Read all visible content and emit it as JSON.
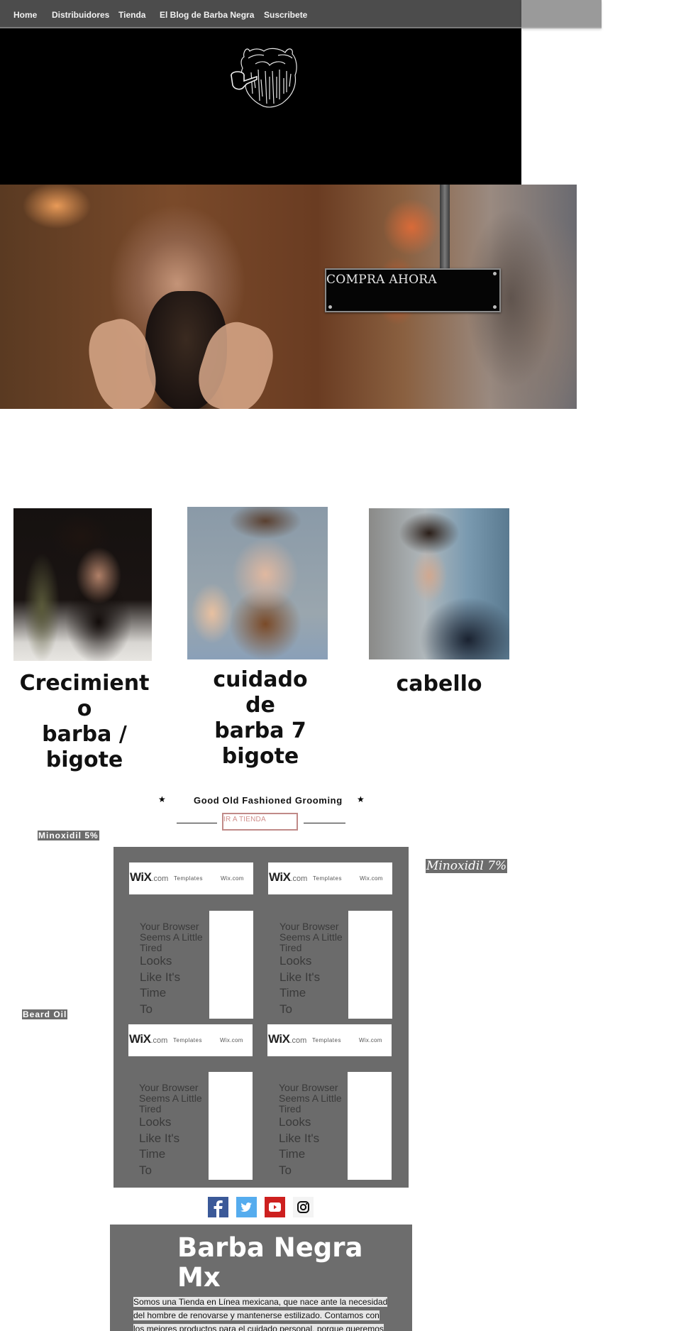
{
  "nav": {
    "items": [
      "Home",
      "Distribuidores",
      "Tienda",
      "El Blog de Barba Negra",
      "Suscribete"
    ]
  },
  "header": {
    "logo_alt": "Barba Negra beard and pipe logo"
  },
  "hero": {
    "cta_label": "COMPRA AHORA"
  },
  "categories": [
    {
      "title_lines": [
        "Crecimient",
        "o",
        "barba /",
        "bigote"
      ]
    },
    {
      "title_lines": [
        "cuidado",
        "de",
        "barba 7",
        "bigote"
      ]
    },
    {
      "title_lines": [
        "cabello"
      ]
    }
  ],
  "grooming": {
    "star": "★",
    "heading": "Good Old Fashioned Grooming",
    "button_label": "IR A TIENDA"
  },
  "products": {
    "minoxidil5": "Minoxidil 5%",
    "minoxidil7": "Minoxidil 7%",
    "beard_oil": "Beard Oil"
  },
  "wix_tiles": [
    {
      "logo": "WiX",
      "logo_suffix": ".com",
      "templates": "Templates",
      "site": "Wix.com",
      "msg_small": [
        "Your Browser",
        "Seems A Little",
        "Tired"
      ],
      "msg_large": [
        "Looks",
        "Like It's",
        "Time",
        "To"
      ]
    },
    {
      "logo": "WiX",
      "logo_suffix": ".com",
      "templates": "Templates",
      "site": "Wix.com",
      "msg_small": [
        "Your Browser",
        "Seems A Little",
        "Tired"
      ],
      "msg_large": [
        "Looks",
        "Like It's",
        "Time",
        "To"
      ]
    },
    {
      "logo": "WiX",
      "logo_suffix": ".com",
      "templates": "Templates",
      "site": "Wix.com",
      "msg_small": [
        "Your Browser",
        "Seems A Little",
        "Tired"
      ],
      "msg_large": [
        "Looks",
        "Like It's",
        "Time",
        "To"
      ]
    },
    {
      "logo": "WiX",
      "logo_suffix": ".com",
      "templates": "Templates",
      "site": "Wix.com",
      "msg_small": [
        "Your Browser",
        "Seems A Little",
        "Tired"
      ],
      "msg_large": [
        "Looks",
        "Like It's",
        "Time",
        "To"
      ]
    }
  ],
  "social": {
    "items": [
      "facebook",
      "twitter",
      "youtube",
      "instagram"
    ],
    "colors": {
      "facebook": "#3b5998",
      "twitter": "#55acee",
      "youtube": "#cd201f",
      "instagram": "#f4f4f4"
    }
  },
  "about": {
    "title_lines": [
      "Barba Negra",
      "Mx"
    ],
    "text_lines": [
      "Somos una Tienda en Línea mexicana, que nace ante la necesidad",
      "del hombre de renovarse y mantenerse estilizado. Contamos con",
      "los mejores productos para el cuidado personal, porque queremos"
    ]
  }
}
